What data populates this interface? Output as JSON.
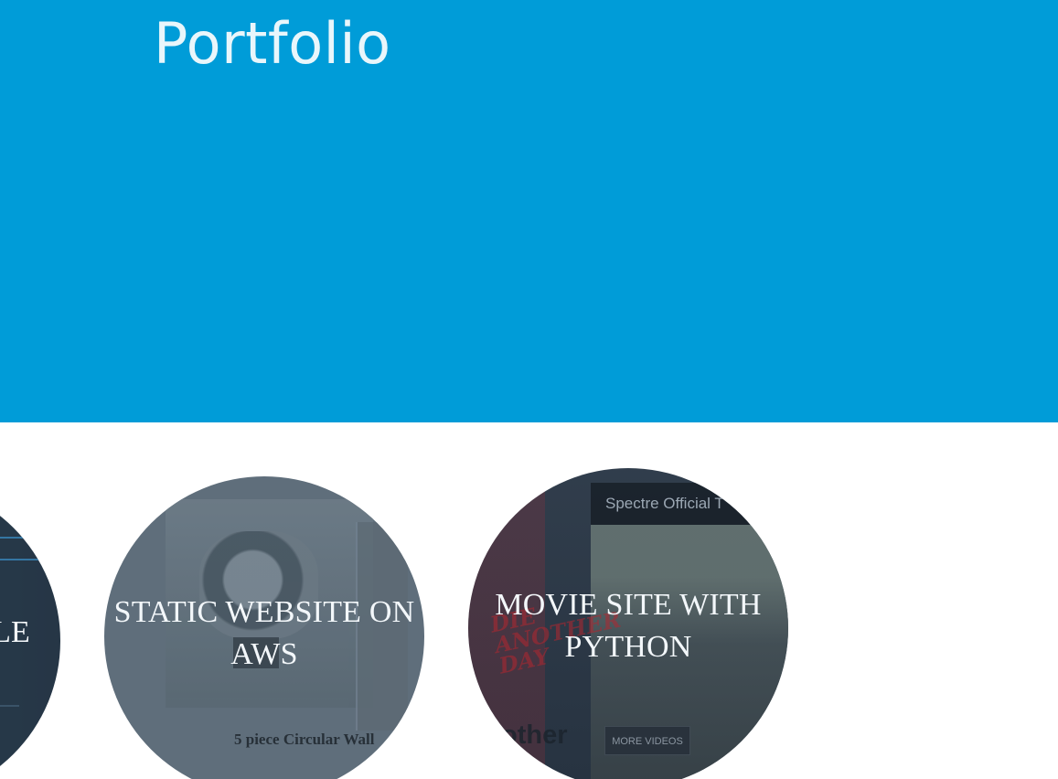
{
  "header": {
    "title": "Portfolio"
  },
  "portfolio": {
    "items": [
      {
        "label": "LE",
        "thumbnail": "code-screen"
      },
      {
        "label": "STATIC WEBSITE ON AWS",
        "thumbnail": "washer-screen",
        "caption": "5 piece Circular Wall"
      },
      {
        "label": "MOVIE SITE WITH PYTHON",
        "thumbnail": "movie-screen",
        "movie_header": "Spectre Official T",
        "more_videos": "MORE VIDEOS",
        "poster_text": "other"
      }
    ]
  },
  "colors": {
    "hero": "#009cd8",
    "hero_text": "#e9f6fb",
    "tile_text": "#f3f7fa",
    "tile_dark": "#263544",
    "tile_mid": "#5f6e7b"
  }
}
